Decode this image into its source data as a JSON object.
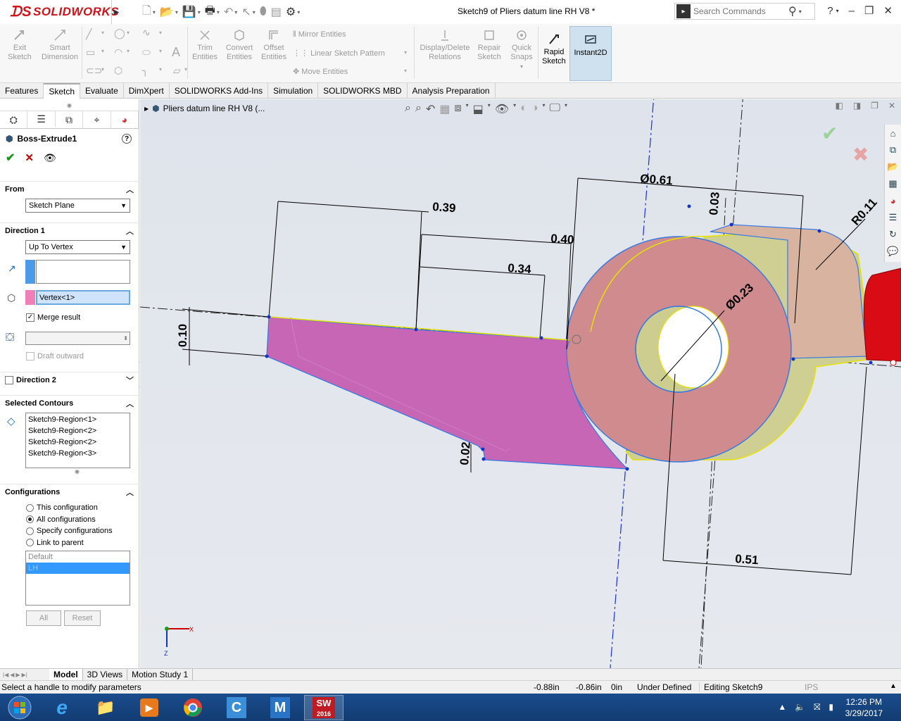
{
  "app": {
    "logo_text": "SOLIDWORKS",
    "doc_title": "Sketch9 of Pliers datum line RH V8 *",
    "search_placeholder": "Search Commands"
  },
  "command_manager": {
    "buttons": {
      "exit_sketch": "Exit Sketch",
      "smart_dimension": "Smart Dimension",
      "trim_entities": "Trim Entities",
      "convert_entities": "Convert Entities",
      "offset_entities": "Offset Entities",
      "mirror_entities": "Mirror Entities",
      "linear_pattern": "Linear Sketch Pattern",
      "move_entities": "Move Entities",
      "display_delete_relations": "Display/Delete Relations",
      "repair_sketch": "Repair Sketch",
      "quick_snaps": "Quick Snaps",
      "rapid_sketch": "Rapid Sketch",
      "instant2d": "Instant2D"
    },
    "tabs": [
      "Features",
      "Sketch",
      "Evaluate",
      "DimXpert",
      "SOLIDWORKS Add-Ins",
      "Simulation",
      "SOLIDWORKS MBD",
      "Analysis Preparation"
    ],
    "active_tab": "Sketch"
  },
  "property_manager": {
    "title": "Boss-Extrude1",
    "from": {
      "label": "From",
      "value": "Sketch Plane"
    },
    "direction1": {
      "label": "Direction 1",
      "end_condition": "Up To Vertex",
      "vertex_value": "Vertex<1>",
      "merge_result_label": "Merge result",
      "merge_result_checked": true,
      "draft_outward_label": "Draft outward"
    },
    "direction2": {
      "label": "Direction 2"
    },
    "selected_contours": {
      "label": "Selected Contours",
      "items": [
        "Sketch9-Region<1>",
        "Sketch9-Region<2>",
        "Sketch9-Region<2>",
        "Sketch9-Region<3>"
      ]
    },
    "configurations": {
      "label": "Configurations",
      "options": [
        "This configuration",
        "All configurations",
        "Specify configurations",
        "Link to parent"
      ],
      "selected": "All configurations",
      "list": [
        "Default",
        "LH"
      ],
      "all_button": "All",
      "reset_button": "Reset"
    }
  },
  "viewport": {
    "tree_flyout": "Pliers datum line RH V8  (...",
    "dimensions": {
      "d061": "Ø0.61",
      "d039": "0.39",
      "d040": "0.40",
      "d034": "0.34",
      "d003": "0.03",
      "r011": "R0.11",
      "d023": "Ø0.23",
      "d010": "0.10",
      "d002": "0.02",
      "d051": "0.51"
    },
    "triad_x": "X",
    "triad_z": "Z"
  },
  "bottom_tabs": [
    "Model",
    "3D Views",
    "Motion Study 1"
  ],
  "active_bottom_tab": "Model",
  "status": {
    "message": "Select a handle to modify parameters",
    "x": "-0.88in",
    "y": "-0.86in",
    "z": "0in",
    "state": "Under Defined",
    "editing": "Editing Sketch9",
    "units": "IPS"
  },
  "taskbar": {
    "time": "12:26 PM",
    "date": "3/29/2017",
    "sw_label": "2016"
  }
}
